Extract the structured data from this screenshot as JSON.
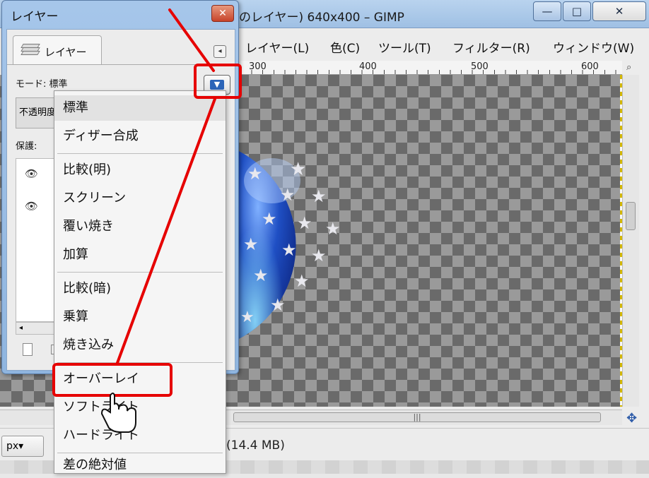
{
  "main_window": {
    "title": "のレイヤー) 640x400 – GIMP",
    "buttons": {
      "minimize": "—",
      "maximize": "□",
      "close": "✕"
    },
    "menus": [
      "レイヤー(L)",
      "色(C)",
      "ツール(T)",
      "フィルター(R)",
      "ウィンドウ(W)"
    ],
    "ruler_labels": [
      "300",
      "400",
      "500",
      "600"
    ],
    "status": {
      "unit": "px▾",
      "text": "(14.4 MB)"
    }
  },
  "layers_dialog": {
    "title": "レイヤー",
    "close_label": "✕",
    "tab_label": "レイヤー",
    "mode_label": "モード: 標準",
    "opacity_label": "不透明度",
    "protect_label": "保護:"
  },
  "mode_menu": {
    "items": [
      "標準",
      "ディザー合成",
      "比較(明)",
      "スクリーン",
      "覆い焼き",
      "加算",
      "比較(暗)",
      "乗算",
      "焼き込み",
      "オーバーレイ",
      "ソフトライト",
      "ハードライト",
      "差の絶対値"
    ],
    "selected": "標準",
    "highlighted": "オーバーレイ"
  },
  "annotation": {
    "color": "#e60000"
  },
  "colors": {
    "accent": "#2b64b8",
    "titlebar": "#a6c6ea",
    "annotation": "#e60000"
  },
  "icons": [
    "layers-icon",
    "dock-menu-icon",
    "eye-icon",
    "hand-cursor-icon",
    "navigate-icon",
    "zoom-icon"
  ]
}
